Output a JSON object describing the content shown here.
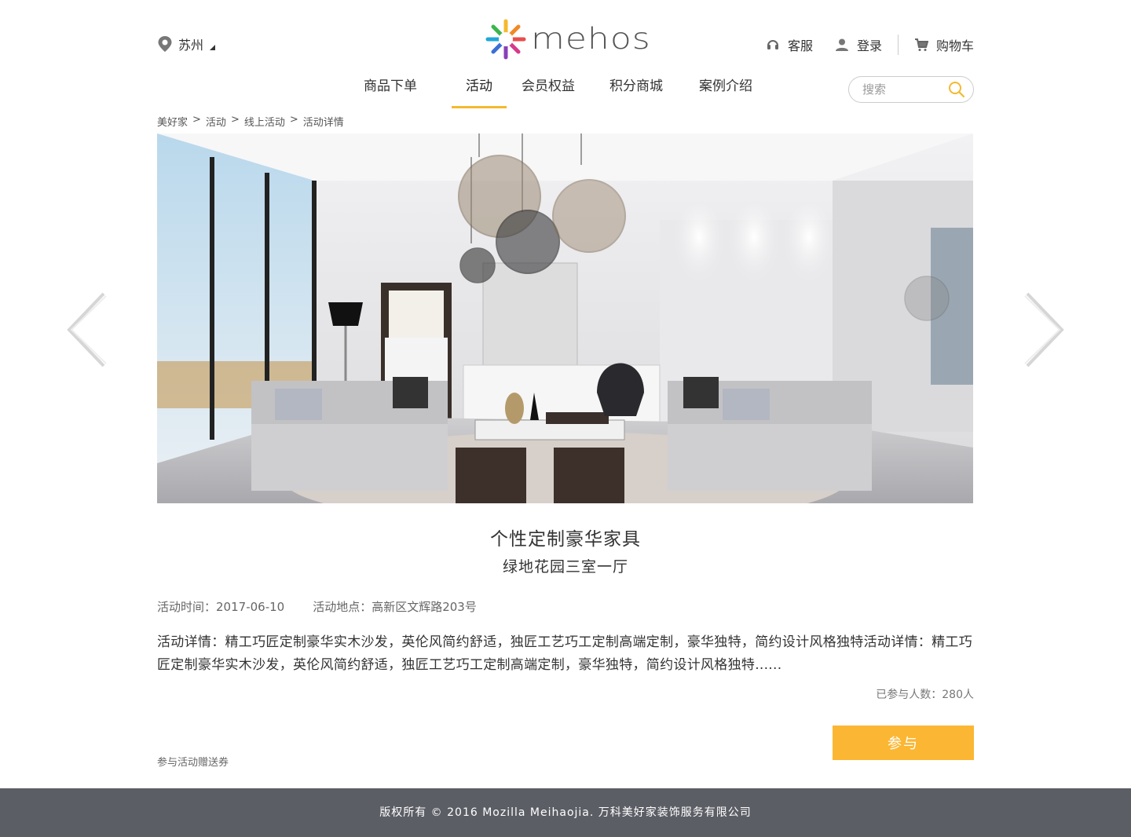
{
  "header": {
    "city": "苏州",
    "logo_text": "mehos",
    "service_label": "客服",
    "login_label": "登录",
    "cart_label": "购物车"
  },
  "nav": {
    "items": [
      "商品下单",
      "活动",
      "会员权益",
      "积分商城",
      "案例介绍"
    ],
    "active_index": 1,
    "search_placeholder": "搜索"
  },
  "breadcrumb": [
    "美好家",
    "活动",
    "线上活动",
    "活动详情"
  ],
  "activity": {
    "title": "个性定制豪华家具",
    "subtitle": "绿地花园三室一厅",
    "time_label": "活动时间：",
    "time_value": "2017-06-10",
    "location_label": "活动地点：",
    "location_value": "高新区文辉路203号",
    "details": "活动详情：精工巧匠定制豪华实木沙发，英伦风简约舒适，独匠工艺巧工定制高端定制，豪华独特，简约设计风格独特活动详情：精工巧匠定制豪华实木沙发，英伦风简约舒适，独匠工艺巧工定制高端定制，豪华独特，简约设计风格独特......",
    "participants_label": "已参与人数：",
    "participants_value": "280人",
    "join_label": "参与",
    "gift_note": "参与活动赠送券"
  },
  "footer": {
    "text": "版权所有 © 2016 Mozilla Meihaojia. 万科美好家装饰服务有限公司"
  },
  "colors": {
    "accent": "#fbb733",
    "nav_underline": "#f5b92e",
    "footer_bg": "#5c5e66"
  }
}
